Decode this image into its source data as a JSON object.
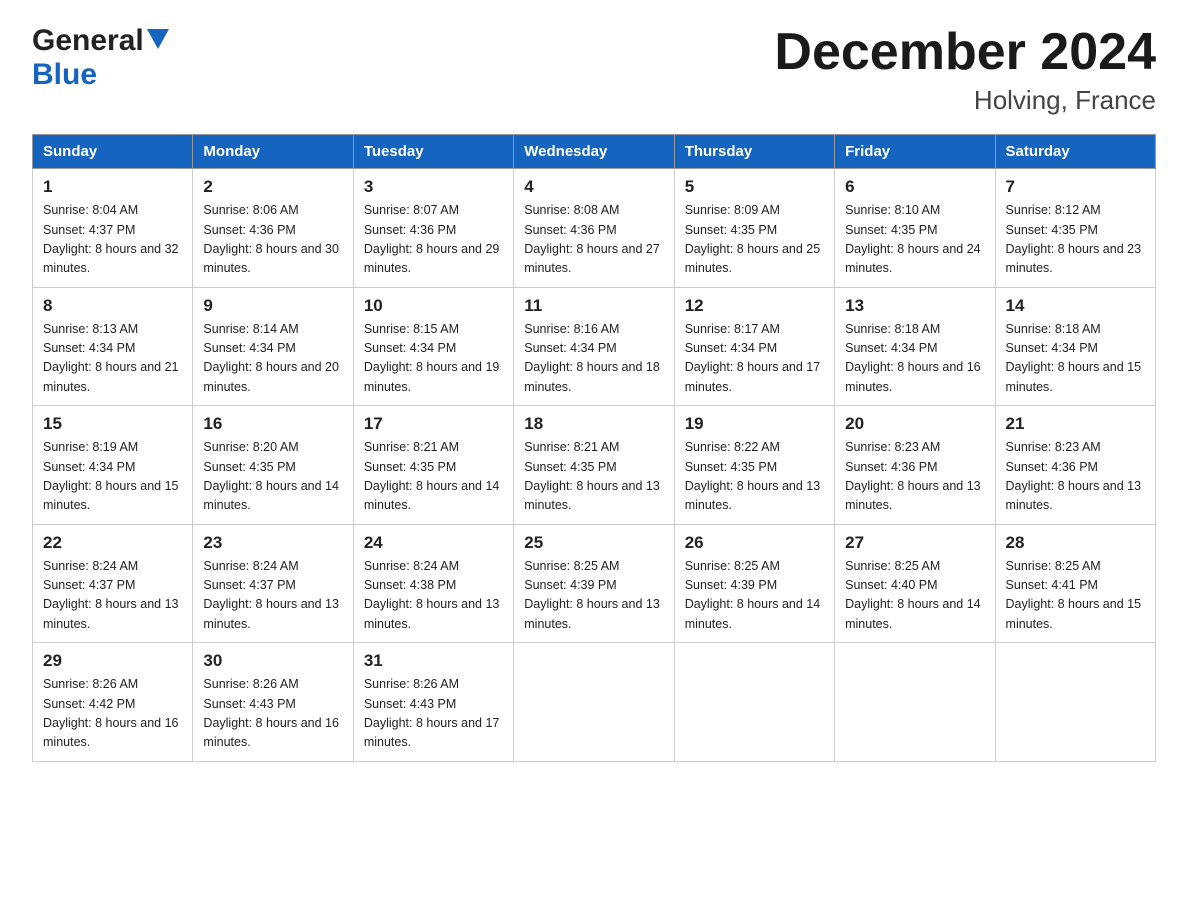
{
  "header": {
    "logo_line1": "General",
    "logo_line2": "Blue",
    "month_title": "December 2024",
    "location": "Holving, France"
  },
  "calendar": {
    "days_of_week": [
      "Sunday",
      "Monday",
      "Tuesday",
      "Wednesday",
      "Thursday",
      "Friday",
      "Saturday"
    ],
    "weeks": [
      [
        {
          "day": "1",
          "sunrise": "8:04 AM",
          "sunset": "4:37 PM",
          "daylight": "8 hours and 32 minutes."
        },
        {
          "day": "2",
          "sunrise": "8:06 AM",
          "sunset": "4:36 PM",
          "daylight": "8 hours and 30 minutes."
        },
        {
          "day": "3",
          "sunrise": "8:07 AM",
          "sunset": "4:36 PM",
          "daylight": "8 hours and 29 minutes."
        },
        {
          "day": "4",
          "sunrise": "8:08 AM",
          "sunset": "4:36 PM",
          "daylight": "8 hours and 27 minutes."
        },
        {
          "day": "5",
          "sunrise": "8:09 AM",
          "sunset": "4:35 PM",
          "daylight": "8 hours and 25 minutes."
        },
        {
          "day": "6",
          "sunrise": "8:10 AM",
          "sunset": "4:35 PM",
          "daylight": "8 hours and 24 minutes."
        },
        {
          "day": "7",
          "sunrise": "8:12 AM",
          "sunset": "4:35 PM",
          "daylight": "8 hours and 23 minutes."
        }
      ],
      [
        {
          "day": "8",
          "sunrise": "8:13 AM",
          "sunset": "4:34 PM",
          "daylight": "8 hours and 21 minutes."
        },
        {
          "day": "9",
          "sunrise": "8:14 AM",
          "sunset": "4:34 PM",
          "daylight": "8 hours and 20 minutes."
        },
        {
          "day": "10",
          "sunrise": "8:15 AM",
          "sunset": "4:34 PM",
          "daylight": "8 hours and 19 minutes."
        },
        {
          "day": "11",
          "sunrise": "8:16 AM",
          "sunset": "4:34 PM",
          "daylight": "8 hours and 18 minutes."
        },
        {
          "day": "12",
          "sunrise": "8:17 AM",
          "sunset": "4:34 PM",
          "daylight": "8 hours and 17 minutes."
        },
        {
          "day": "13",
          "sunrise": "8:18 AM",
          "sunset": "4:34 PM",
          "daylight": "8 hours and 16 minutes."
        },
        {
          "day": "14",
          "sunrise": "8:18 AM",
          "sunset": "4:34 PM",
          "daylight": "8 hours and 15 minutes."
        }
      ],
      [
        {
          "day": "15",
          "sunrise": "8:19 AM",
          "sunset": "4:34 PM",
          "daylight": "8 hours and 15 minutes."
        },
        {
          "day": "16",
          "sunrise": "8:20 AM",
          "sunset": "4:35 PM",
          "daylight": "8 hours and 14 minutes."
        },
        {
          "day": "17",
          "sunrise": "8:21 AM",
          "sunset": "4:35 PM",
          "daylight": "8 hours and 14 minutes."
        },
        {
          "day": "18",
          "sunrise": "8:21 AM",
          "sunset": "4:35 PM",
          "daylight": "8 hours and 13 minutes."
        },
        {
          "day": "19",
          "sunrise": "8:22 AM",
          "sunset": "4:35 PM",
          "daylight": "8 hours and 13 minutes."
        },
        {
          "day": "20",
          "sunrise": "8:23 AM",
          "sunset": "4:36 PM",
          "daylight": "8 hours and 13 minutes."
        },
        {
          "day": "21",
          "sunrise": "8:23 AM",
          "sunset": "4:36 PM",
          "daylight": "8 hours and 13 minutes."
        }
      ],
      [
        {
          "day": "22",
          "sunrise": "8:24 AM",
          "sunset": "4:37 PM",
          "daylight": "8 hours and 13 minutes."
        },
        {
          "day": "23",
          "sunrise": "8:24 AM",
          "sunset": "4:37 PM",
          "daylight": "8 hours and 13 minutes."
        },
        {
          "day": "24",
          "sunrise": "8:24 AM",
          "sunset": "4:38 PM",
          "daylight": "8 hours and 13 minutes."
        },
        {
          "day": "25",
          "sunrise": "8:25 AM",
          "sunset": "4:39 PM",
          "daylight": "8 hours and 13 minutes."
        },
        {
          "day": "26",
          "sunrise": "8:25 AM",
          "sunset": "4:39 PM",
          "daylight": "8 hours and 14 minutes."
        },
        {
          "day": "27",
          "sunrise": "8:25 AM",
          "sunset": "4:40 PM",
          "daylight": "8 hours and 14 minutes."
        },
        {
          "day": "28",
          "sunrise": "8:25 AM",
          "sunset": "4:41 PM",
          "daylight": "8 hours and 15 minutes."
        }
      ],
      [
        {
          "day": "29",
          "sunrise": "8:26 AM",
          "sunset": "4:42 PM",
          "daylight": "8 hours and 16 minutes."
        },
        {
          "day": "30",
          "sunrise": "8:26 AM",
          "sunset": "4:43 PM",
          "daylight": "8 hours and 16 minutes."
        },
        {
          "day": "31",
          "sunrise": "8:26 AM",
          "sunset": "4:43 PM",
          "daylight": "8 hours and 17 minutes."
        },
        null,
        null,
        null,
        null
      ]
    ]
  }
}
